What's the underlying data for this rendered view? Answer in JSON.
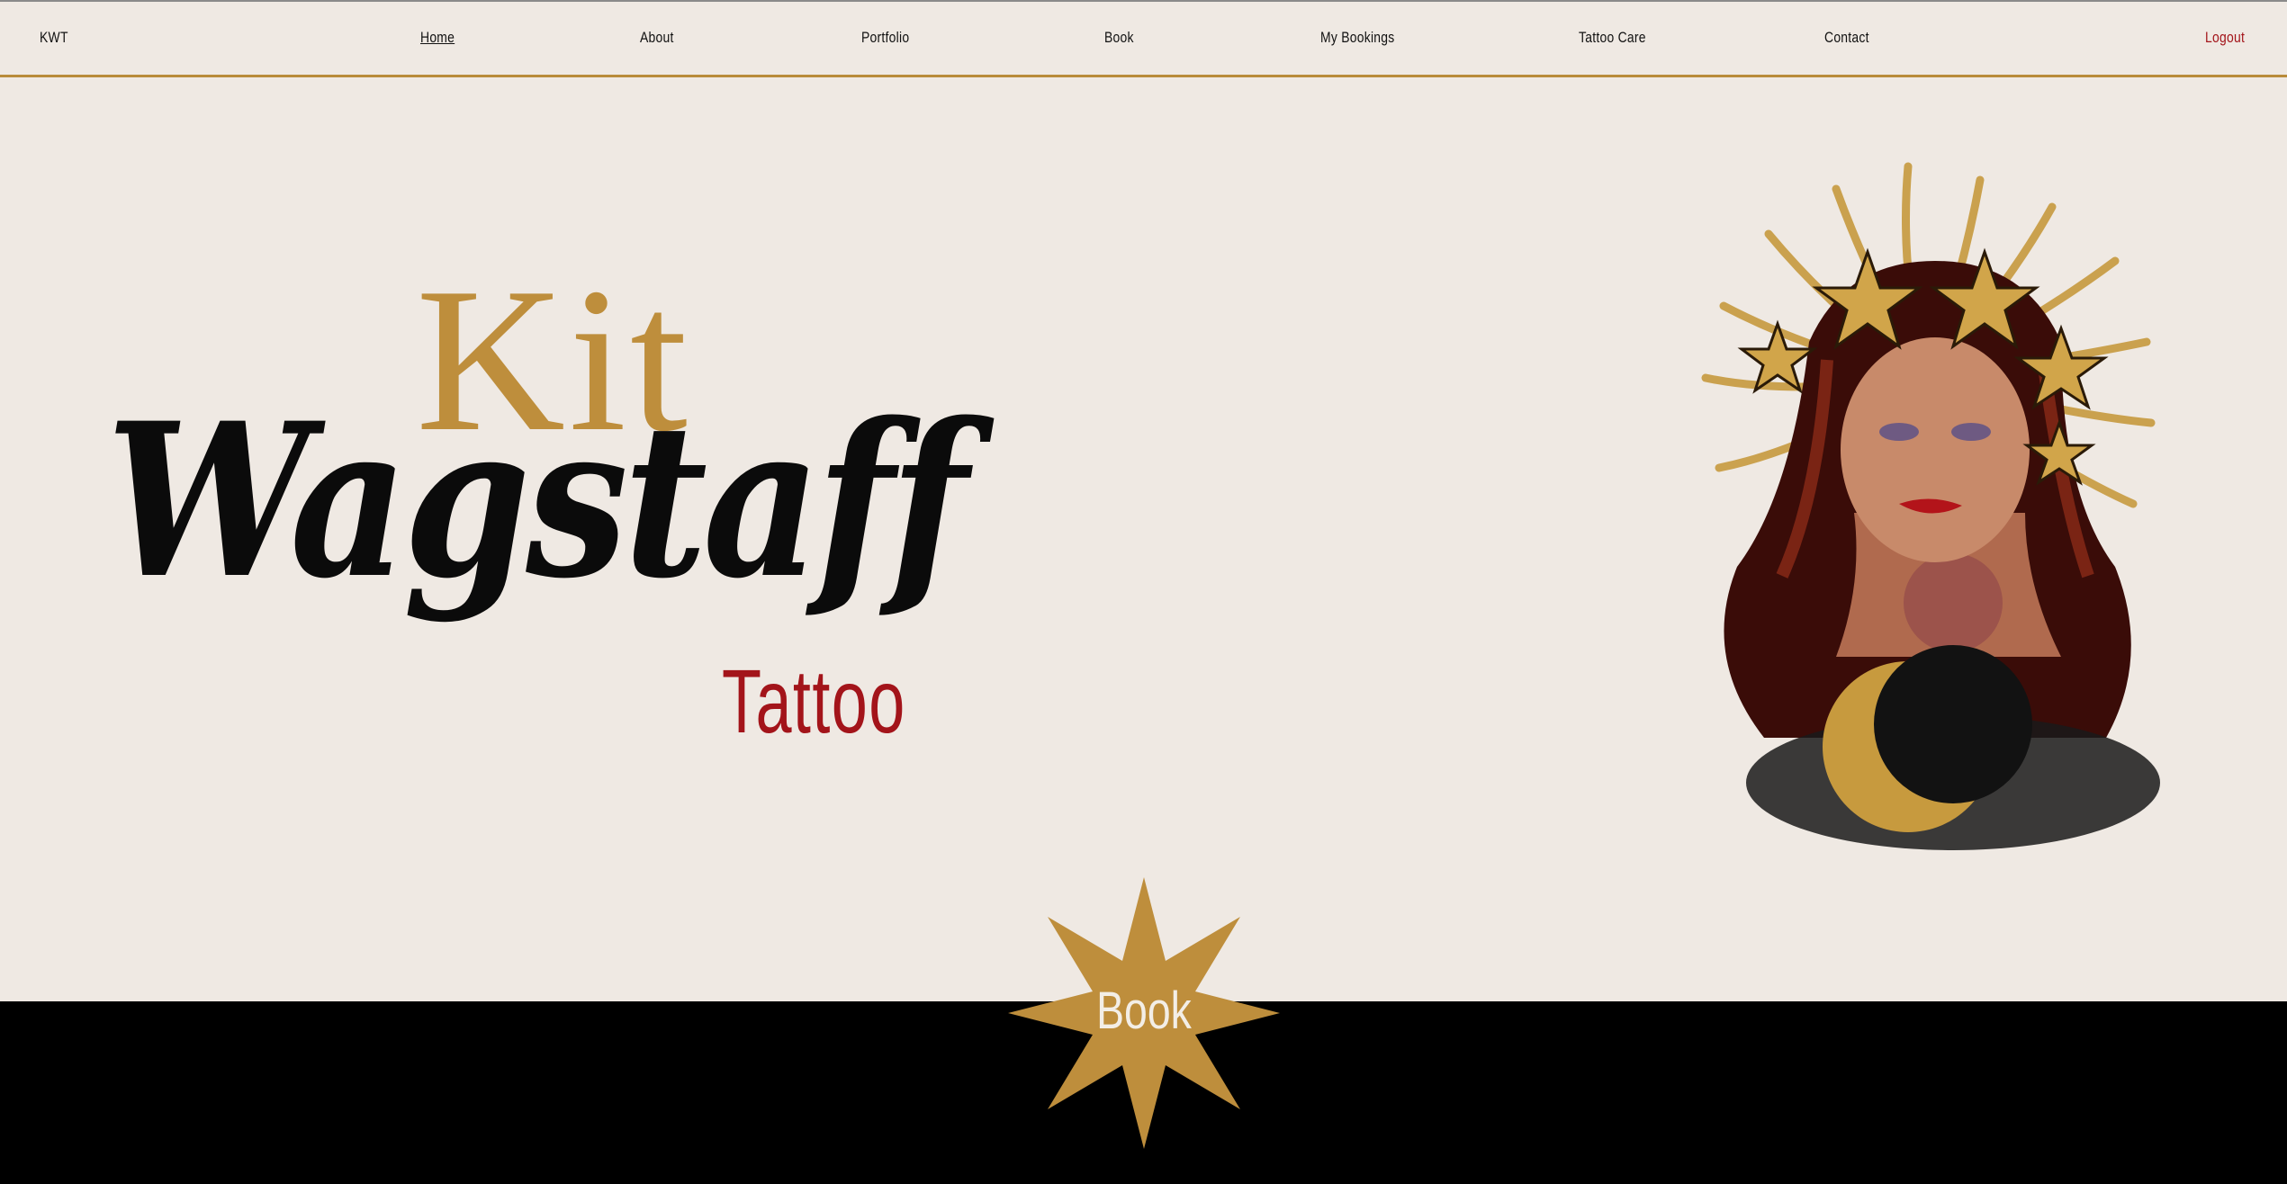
{
  "nav": {
    "brand": "KWT",
    "items": [
      {
        "label": "Home",
        "active": true
      },
      {
        "label": "About"
      },
      {
        "label": "Portfolio"
      },
      {
        "label": "Book"
      },
      {
        "label": "My Bookings"
      },
      {
        "label": "Tattoo Care"
      },
      {
        "label": "Contact"
      }
    ],
    "logout": "Logout"
  },
  "hero": {
    "first_name": "Kit",
    "last_name": "Wagstaff",
    "subtitle": "Tattoo"
  },
  "cta": {
    "book_label": "Book"
  },
  "colors": {
    "background": "#efe9e3",
    "gold": "#be8e3c",
    "red": "#a3141a",
    "black": "#000000"
  },
  "icons": {
    "portrait": "woman-sun-stars-moon-illustration",
    "book_button_shape": "eight-point-star"
  }
}
